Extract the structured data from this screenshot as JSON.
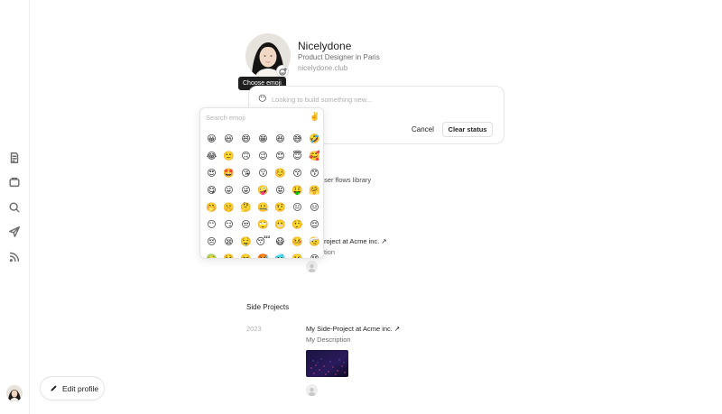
{
  "profile": {
    "name": "Nicelydone",
    "role": "Product Designer in Paris",
    "website": "nicelydone.club",
    "emoji_tooltip": "Choose emoji"
  },
  "status": {
    "emoji": "😶",
    "placeholder": "Looking to build something new...",
    "cancel_label": "Cancel",
    "clear_label": "Clear status"
  },
  "emoji_picker": {
    "search_placeholder": "Search emoji",
    "skin_tone": "✌️",
    "emojis": [
      "😀",
      "😃",
      "😄",
      "😁",
      "😆",
      "😅",
      "🤣",
      "😂",
      "🙂",
      "🙃",
      "😉",
      "😊",
      "😇",
      "🥰",
      "😍",
      "🤩",
      "😘",
      "😗",
      "☺️",
      "😚",
      "😙",
      "😋",
      "😛",
      "😜",
      "🤪",
      "😝",
      "🤑",
      "🤗",
      "🤭",
      "🤫",
      "🤔",
      "🤐",
      "🤨",
      "😐",
      "😑",
      "😶",
      "😏",
      "😒",
      "🙄",
      "😬",
      "🤥",
      "😌",
      "😔",
      "😪",
      "🤤",
      "😴",
      "😷",
      "🤒",
      "🤕",
      "🤢",
      "🤮",
      "🤧",
      "🥵",
      "🥶",
      "🥴",
      "😵"
    ]
  },
  "work_partial": {
    "library_text": "s & user flows library",
    "project_title": "reat Project at Acme inc. ↗",
    "project_desc": "escription"
  },
  "side_projects": {
    "title": "Side Projects",
    "items": [
      {
        "year": "2023",
        "title": "My Side-Project at Acme inc. ↗",
        "description": "My Description"
      }
    ]
  },
  "edit_profile_label": "Edit profile",
  "nav_icons": [
    "notes-icon",
    "folder-icon",
    "search-icon",
    "send-icon",
    "rss-icon"
  ]
}
